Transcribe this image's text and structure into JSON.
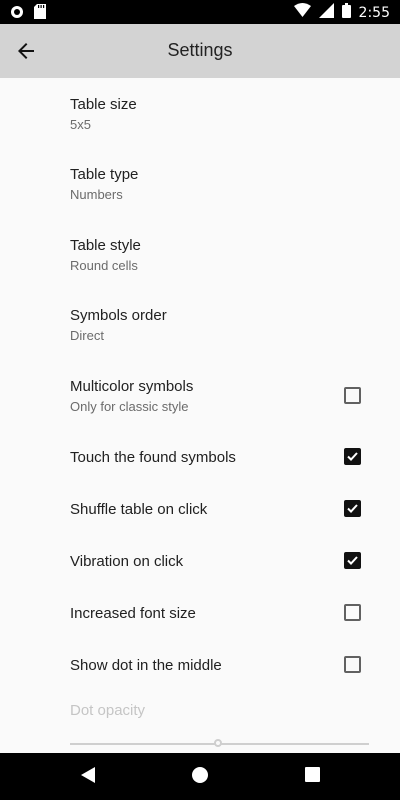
{
  "status": {
    "time": "2:55"
  },
  "header": {
    "title": "Settings"
  },
  "prefs": [
    {
      "title": "Table size",
      "summary": "5x5"
    },
    {
      "title": "Table type",
      "summary": "Numbers"
    },
    {
      "title": "Table style",
      "summary": "Round cells"
    },
    {
      "title": "Symbols order",
      "summary": "Direct"
    },
    {
      "title": "Multicolor symbols",
      "summary": "Only for classic style",
      "checked": false
    },
    {
      "title": "Touch the found symbols",
      "checked": true
    },
    {
      "title": "Shuffle table on click",
      "checked": true
    },
    {
      "title": "Vibration on click",
      "checked": true
    },
    {
      "title": "Increased font size",
      "checked": false
    },
    {
      "title": "Show dot in the middle",
      "checked": false
    }
  ],
  "dot_opacity": {
    "title": "Dot opacity",
    "value": 0.5
  }
}
